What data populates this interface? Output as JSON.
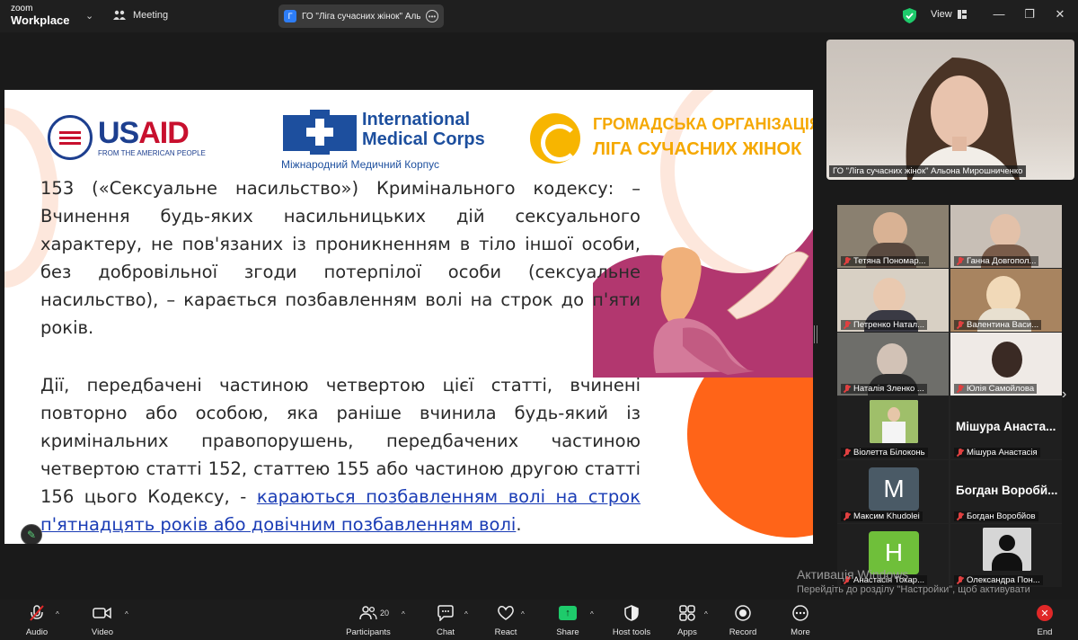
{
  "app": {
    "brand_line1": "zoom",
    "brand_line2": "Workplace",
    "meeting_label": "Meeting",
    "tab_title": "ГО \"Ліга сучасних жінок\" Альона Мирошниченко",
    "tab_icon_letter": "Г",
    "view_label": "View",
    "accent": "#2d7df6",
    "security_color": "#1ecb6b"
  },
  "slide": {
    "usaid_word_us": "US",
    "usaid_word_aid": "AID",
    "usaid_tagline": "FROM THE AMERICAN PEOPLE",
    "imc_name_line1": "International",
    "imc_name_line2": "Medical Corps",
    "imc_subtitle": "Міжнародний Медичний Корпус",
    "liga_line1": "ГРОМАДСЬКА ОРГАНІЗАЦІЯ",
    "liga_line2": "ЛІГА СУЧАСНИХ ЖІНОК",
    "paragraph1": "153 («Сексуальне насильство») Кримінального кодексу: – Вчинення будь-яких насильницьких дій сексуального характеру, не пов'язаних із проникненням в тіло іншої особи, без добровільної згоди потерпілої особи (сексуальне насильство), – карається позбавленням волі на строк до п'яти років.",
    "paragraph2_plain": "Дії, передбачені частиною четвертою цієї статті, вчинені повторно або особою, яка раніше вчинила будь-який із кримінальних правопорушень, передбачених частиною четвертою статті 152, статтею 155 або частиною другою статті 156 цього Кодексу, - ",
    "paragraph2_link": "караються позбавленням волі на строк п'ятнадцять років або довічним позбавленням волі",
    "paragraph2_end": ".",
    "orange": "#ff6418"
  },
  "speaker": {
    "label": "ГО \"Ліга сучасних жінок\" Альона Мирошниченко"
  },
  "gallery": {
    "tiles": [
      {
        "name": "Тетяна Пономар..."
      },
      {
        "name": "Ганна Довгопол..."
      },
      {
        "name": "Петренко Натал..."
      },
      {
        "name": "Валентина Васи..."
      },
      {
        "name": "Наталія Зленко ..."
      },
      {
        "name": "Юлія Самойлова"
      },
      {
        "name": "Віолетта Білоконь"
      },
      {
        "name": "Мішура Анастасія",
        "bigname": "Мішура Анаста..."
      },
      {
        "name": "Максим Khudolei",
        "letter": "M",
        "color": "#4a5a66"
      },
      {
        "name": "Богдан Воробйов",
        "bigname": "Богдан Воробй..."
      },
      {
        "name": "Анастасія Токар...",
        "letter": "H",
        "color": "#6fbf3a"
      },
      {
        "name": "Олександра Пон..."
      }
    ]
  },
  "watermark": {
    "title": "Активація Windows",
    "subtitle": "Перейдіть до розділу \"Настройки\", щоб активувати Windows."
  },
  "toolbar": {
    "audio": "Audio",
    "video": "Video",
    "participants": "Participants",
    "participants_count": "20",
    "chat": "Chat",
    "react": "React",
    "share": "Share",
    "host_tools": "Host tools",
    "apps": "Apps",
    "record": "Record",
    "more": "More",
    "end": "End",
    "share_color": "#1ecb6b",
    "end_color": "#e02828"
  }
}
